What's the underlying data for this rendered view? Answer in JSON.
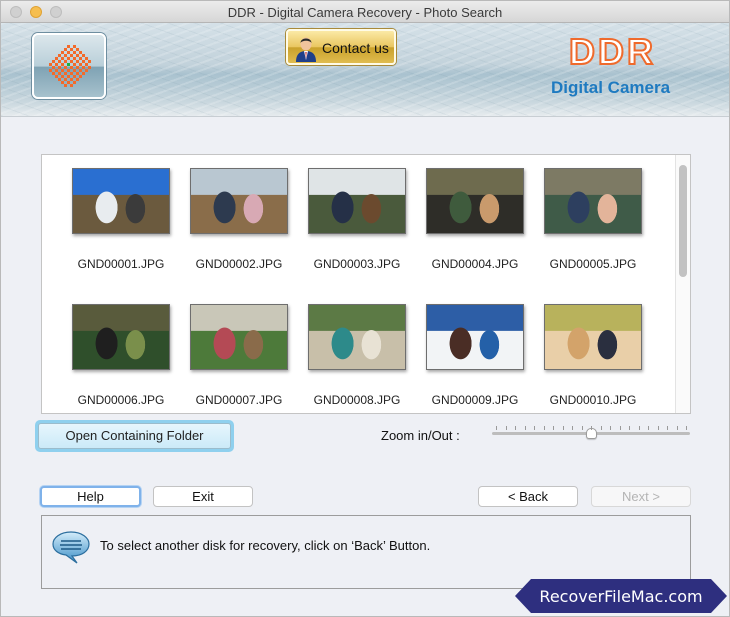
{
  "window": {
    "title": "DDR - Digital Camera Recovery - Photo Search"
  },
  "banner": {
    "contact_label": "Contact us",
    "brand_name": "DDR",
    "brand_subtitle": "Digital Camera",
    "colors": {
      "brand_orange": "#ef6a2c",
      "brand_blue": "#1e7ac0"
    }
  },
  "photos": [
    {
      "filename": "GND00001.JPG",
      "scene": "hikers-mountain"
    },
    {
      "filename": "GND00002.JPG",
      "scene": "students-picnic-table"
    },
    {
      "filename": "GND00003.JPG",
      "scene": "group-with-eagle"
    },
    {
      "filename": "GND00004.JPG",
      "scene": "people-with-mugs-forest"
    },
    {
      "filename": "GND00005.JPG",
      "scene": "couple-selfie"
    },
    {
      "filename": "GND00006.JPG",
      "scene": "group-walking-field"
    },
    {
      "filename": "GND00007.JPG",
      "scene": "pond-dipping-boardwalk"
    },
    {
      "filename": "GND00008.JPG",
      "scene": "couple-walking-path"
    },
    {
      "filename": "GND00009.JPG",
      "scene": "person-on-snow"
    },
    {
      "filename": "GND00010.JPG",
      "scene": "mother-daughter"
    }
  ],
  "controls": {
    "open_folder_label": "Open Containing Folder",
    "zoom_label": "Zoom in/Out :",
    "zoom_value_fraction": 0.5
  },
  "nav": {
    "help_label": "Help",
    "exit_label": "Exit",
    "back_label": "< Back",
    "next_label": "Next >"
  },
  "message": {
    "text": "To select another disk for recovery, click on ‘Back’ Button."
  },
  "watermark": {
    "text": "RecoverFileMac.com",
    "color": "#2e2f7f"
  }
}
